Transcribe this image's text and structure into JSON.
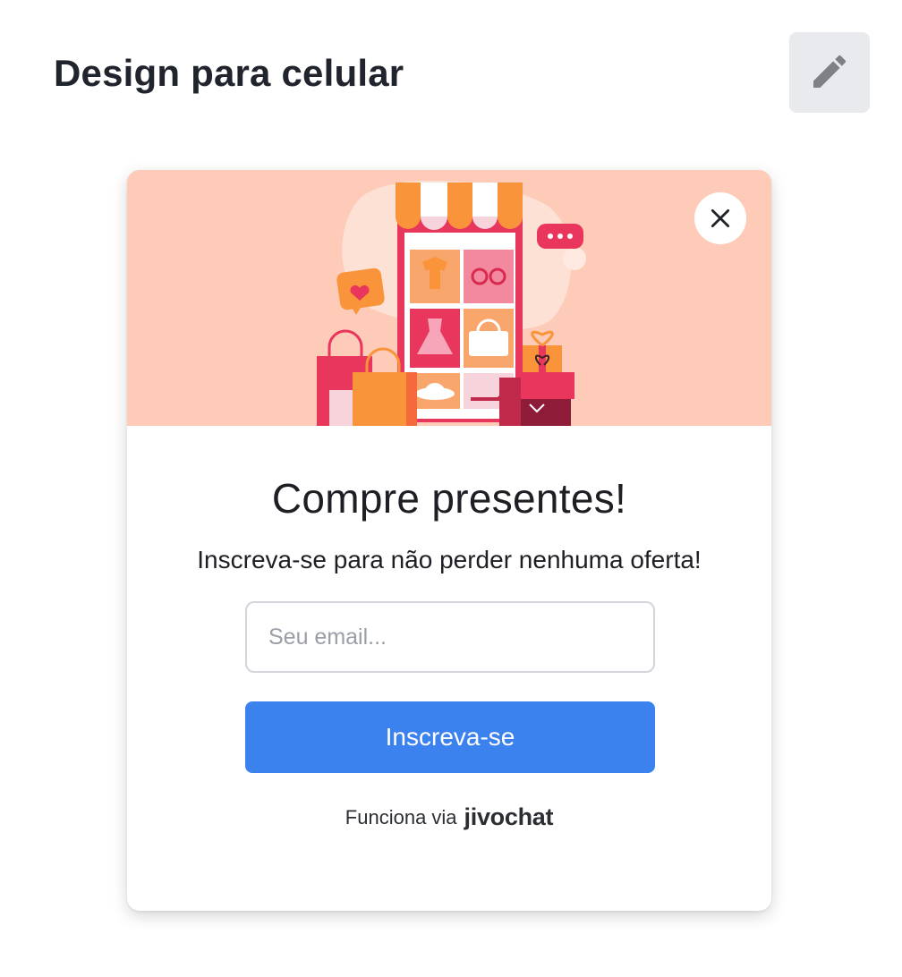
{
  "page": {
    "title": "Design para celular",
    "edit_icon": "pencil-icon"
  },
  "popup": {
    "close_icon": "close-icon",
    "illustration": "shop-gifts-illustration",
    "headline": "Compre presentes!",
    "subtitle": "Inscreva-se para não perder nenhuma oferta!",
    "email": {
      "value": "",
      "placeholder": "Seu email..."
    },
    "submit_label": "Inscreva-se",
    "powered_by_text": "Funciona via",
    "brand": "jivochat"
  },
  "colors": {
    "banner": "#fecbb8",
    "button": "#3b82ee",
    "edit_button_bg": "#e8eaed",
    "brand_accent": "#27b34a"
  }
}
